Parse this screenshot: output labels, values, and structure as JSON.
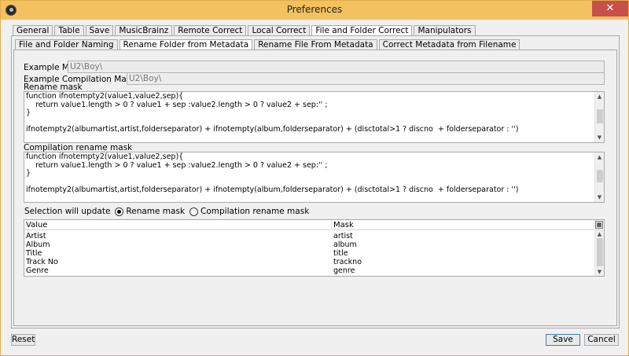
{
  "window": {
    "title": "Preferences",
    "close_symbol": "✕"
  },
  "top_tabs": [
    {
      "label": "General"
    },
    {
      "label": "Table"
    },
    {
      "label": "Save"
    },
    {
      "label": "MusicBrainz"
    },
    {
      "label": "Remote Correct"
    },
    {
      "label": "Local Correct"
    },
    {
      "label": "File and Folder Correct",
      "active": true
    },
    {
      "label": "Manipulators"
    }
  ],
  "sub_tabs": [
    {
      "label": "File and Folder Naming"
    },
    {
      "label": "Rename Folder from Metadata",
      "active": true
    },
    {
      "label": "Rename File From Metadata"
    },
    {
      "label": "Correct Metadata from Filename"
    }
  ],
  "example_mask": {
    "label": "Example Mask:",
    "value": "U2\\Boy\\"
  },
  "example_compilation_mask": {
    "label": "Example Compilation Mask:",
    "value": "U2\\Boy\\"
  },
  "rename_mask": {
    "label": "Rename mask",
    "lines": [
      "function ifnotempty2(value1,value2,sep){",
      "    return value1.length > 0 ? value1 + sep :value2.length > 0 ? value2 + sep:'' ;",
      "}",
      "",
      "ifnotempty2(albumartist,artist,folderseparator) + ifnotempty(album,folderseparator) + (disctotal>1 ? discno  + folderseparator : '')"
    ]
  },
  "compilation_rename_mask": {
    "label": "Compilation rename mask",
    "lines": [
      "function ifnotempty2(value1,value2,sep){",
      "    return value1.length > 0 ? value1 + sep :value2.length > 0 ? value2 + sep:'' ;",
      "}",
      "",
      "ifnotempty2(albumartist,artist,folderseparator) + ifnotempty(album,folderseparator) + (disctotal>1 ? discno  + folderseparator : '')"
    ]
  },
  "selection": {
    "label": "Selection will update",
    "options": [
      {
        "label": "Rename mask",
        "checked": true
      },
      {
        "label": "Compilation rename mask",
        "checked": false
      }
    ]
  },
  "table": {
    "columns": [
      "Value",
      "Mask"
    ],
    "rows": [
      {
        "value": "Artist",
        "mask": "artist"
      },
      {
        "value": "Album",
        "mask": "album"
      },
      {
        "value": "Title",
        "mask": "title"
      },
      {
        "value": "Track No",
        "mask": "trackno"
      },
      {
        "value": "Genre",
        "mask": "genre"
      }
    ]
  },
  "buttons": {
    "reset": "Reset",
    "save": "Save",
    "cancel": "Cancel"
  },
  "colors": {
    "titlebar": "#f3c15f",
    "close": "#c7504b",
    "default_button_border": "#3c7fb1"
  }
}
